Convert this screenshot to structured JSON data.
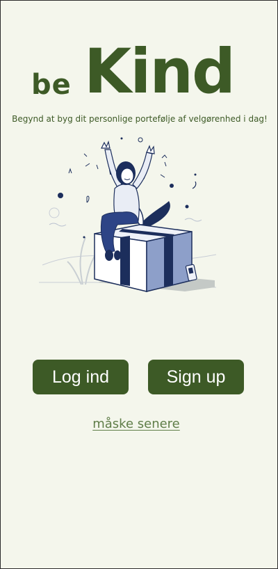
{
  "app": {
    "logo_be": "be",
    "logo_kind": "Kind",
    "tagline": "Begynd at byg dit personlige portefølje af velgørenhed i dag!"
  },
  "illustration": {
    "icon": "person-celebrating-on-gift-box"
  },
  "actions": {
    "login_label": "Log ind",
    "signup_label": "Sign up",
    "later_label": "måske senere"
  },
  "colors": {
    "background": "#f4f6ec",
    "brand_green": "#3d5a26",
    "link_green": "#5f7d48",
    "navy": "#1c2e5c",
    "box_blue": "#8d9fc9"
  }
}
